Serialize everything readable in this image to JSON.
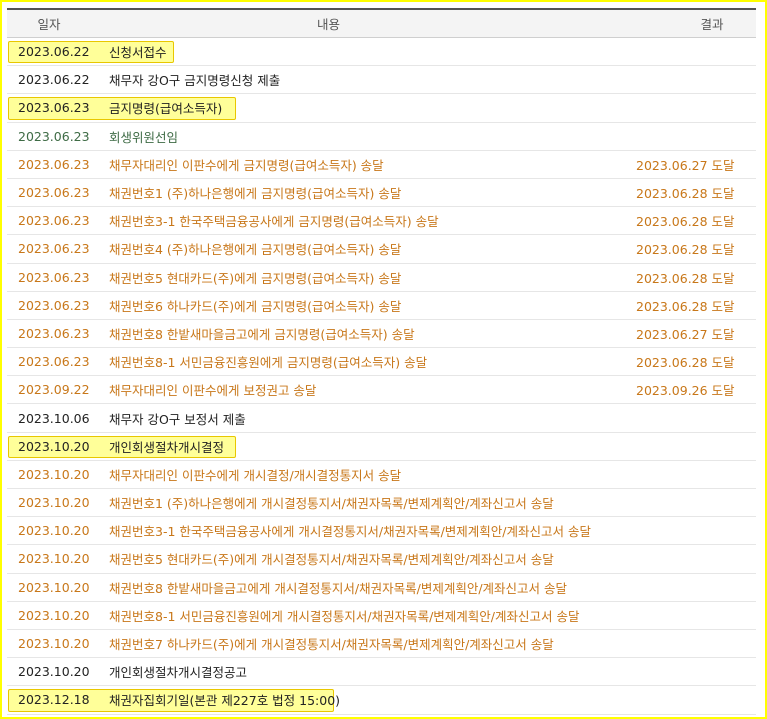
{
  "header": {
    "date": "일자",
    "content": "내용",
    "result": "결과"
  },
  "rows": [
    {
      "date": "2023.06.22",
      "content": "신청서접수",
      "result": "",
      "color": "black",
      "hl": 166
    },
    {
      "date": "2023.06.22",
      "content": "채무자 강O구 금지명령신청 제출",
      "result": "",
      "color": "black"
    },
    {
      "date": "2023.06.23",
      "content": "금지명령(급여소득자)",
      "result": "",
      "color": "black",
      "hl": 228
    },
    {
      "date": "2023.06.23",
      "content": "회생위원선임",
      "result": "",
      "color": "green"
    },
    {
      "date": "2023.06.23",
      "content": "채무자대리인 이판수에게 금지명령(급여소득자) 송달",
      "result": "2023.06.27 도달",
      "color": "orange"
    },
    {
      "date": "2023.06.23",
      "content": "채권번호1 (주)하나은행에게 금지명령(급여소득자) 송달",
      "result": "2023.06.28 도달",
      "color": "orange"
    },
    {
      "date": "2023.06.23",
      "content": "채권번호3-1 한국주택금융공사에게 금지명령(급여소득자) 송달",
      "result": "2023.06.28 도달",
      "color": "orange"
    },
    {
      "date": "2023.06.23",
      "content": "채권번호4 (주)하나은행에게 금지명령(급여소득자) 송달",
      "result": "2023.06.28 도달",
      "color": "orange"
    },
    {
      "date": "2023.06.23",
      "content": "채권번호5 현대카드(주)에게 금지명령(급여소득자) 송달",
      "result": "2023.06.28 도달",
      "color": "orange"
    },
    {
      "date": "2023.06.23",
      "content": "채권번호6 하나카드(주)에게 금지명령(급여소득자) 송달",
      "result": "2023.06.28 도달",
      "color": "orange"
    },
    {
      "date": "2023.06.23",
      "content": "채권번호8 한밭새마을금고에게 금지명령(급여소득자) 송달",
      "result": "2023.06.27 도달",
      "color": "orange"
    },
    {
      "date": "2023.06.23",
      "content": "채권번호8-1 서민금융진흥원에게 금지명령(급여소득자) 송달",
      "result": "2023.06.28 도달",
      "color": "orange"
    },
    {
      "date": "2023.09.22",
      "content": "채무자대리인 이판수에게 보정권고 송달",
      "result": "2023.09.26 도달",
      "color": "orange"
    },
    {
      "date": "2023.10.06",
      "content": "채무자 강O구 보정서 제출",
      "result": "",
      "color": "black"
    },
    {
      "date": "2023.10.20",
      "content": "개인회생절차개시결정",
      "result": "",
      "color": "black",
      "hl": 228
    },
    {
      "date": "2023.10.20",
      "content": "채무자대리인 이판수에게 개시결정/개시결정통지서 송달",
      "result": "",
      "color": "orange"
    },
    {
      "date": "2023.10.20",
      "content": "채권번호1 (주)하나은행에게 개시결정통지서/채권자목록/변제계획안/계좌신고서 송달",
      "result": "",
      "color": "orange"
    },
    {
      "date": "2023.10.20",
      "content": "채권번호3-1 한국주택금융공사에게 개시결정통지서/채권자목록/변제계획안/계좌신고서 송달",
      "result": "",
      "color": "orange"
    },
    {
      "date": "2023.10.20",
      "content": "채권번호5 현대카드(주)에게 개시결정통지서/채권자목록/변제계획안/계좌신고서 송달",
      "result": "",
      "color": "orange"
    },
    {
      "date": "2023.10.20",
      "content": "채권번호8 한밭새마을금고에게 개시결정통지서/채권자목록/변제계획안/계좌신고서 송달",
      "result": "",
      "color": "orange"
    },
    {
      "date": "2023.10.20",
      "content": "채권번호8-1 서민금융진흥원에게 개시결정통지서/채권자목록/변제계획안/계좌신고서 송달",
      "result": "",
      "color": "orange"
    },
    {
      "date": "2023.10.20",
      "content": "채권번호7 하나카드(주)에게 개시결정통지서/채권자목록/변제계획안/계좌신고서 송달",
      "result": "",
      "color": "orange"
    },
    {
      "date": "2023.10.20",
      "content": "개인회생절차개시결정공고",
      "result": "",
      "color": "black"
    },
    {
      "date": "2023.12.18",
      "content": "채권자집회기일(본관 제227호 법정 15:00)",
      "result": "",
      "color": "black",
      "hl": 326
    }
  ]
}
